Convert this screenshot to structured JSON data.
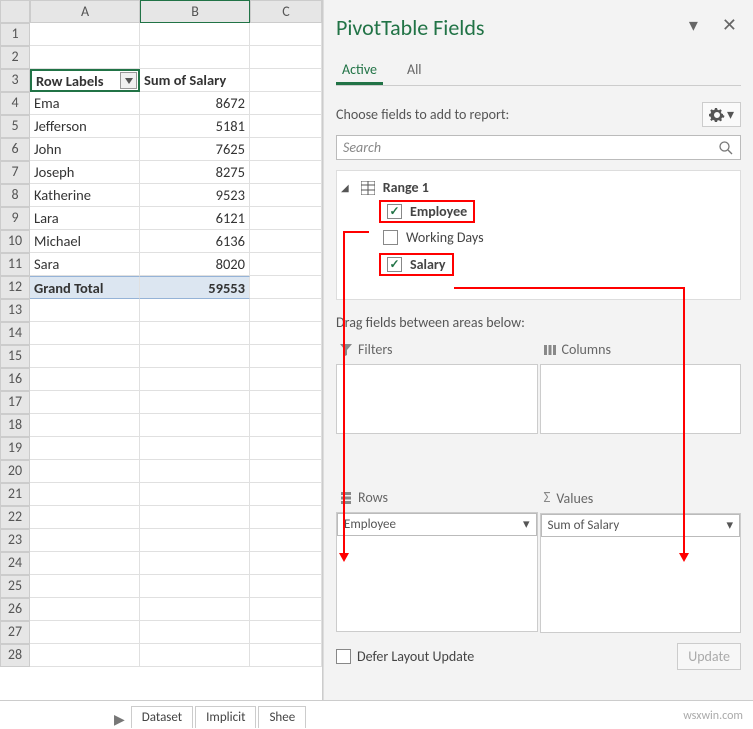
{
  "spreadsheet": {
    "columns": [
      "A",
      "B",
      "C"
    ],
    "header_row": {
      "a": "Row Labels",
      "b": "Sum of Salary"
    },
    "rows": [
      {
        "n": 4,
        "a": "Ema",
        "b": "8672"
      },
      {
        "n": 5,
        "a": "Jefferson",
        "b": "5181"
      },
      {
        "n": 6,
        "a": "John",
        "b": "7625"
      },
      {
        "n": 7,
        "a": "Joseph",
        "b": "8275"
      },
      {
        "n": 8,
        "a": "Katherine",
        "b": "9523"
      },
      {
        "n": 9,
        "a": "Lara",
        "b": "6121"
      },
      {
        "n": 10,
        "a": "Michael",
        "b": "6136"
      },
      {
        "n": 11,
        "a": "Sara",
        "b": "8020"
      }
    ],
    "grand_total": {
      "n": 12,
      "a": "Grand Total",
      "b": "59553"
    },
    "blank_rows": [
      1,
      2,
      13,
      14,
      15,
      16,
      17,
      18,
      19,
      20,
      21,
      22,
      23,
      24,
      25,
      26,
      27,
      28
    ],
    "tabs": [
      "Dataset",
      "Implicit",
      "Shee"
    ]
  },
  "pane": {
    "title": "PivotTable Fields",
    "tabs": {
      "active": "Active",
      "all": "All"
    },
    "choose_text": "Choose fields to add to report:",
    "search_placeholder": "Search",
    "range_name": "Range 1",
    "fields": [
      {
        "name": "Employee",
        "checked": true,
        "highlight": true
      },
      {
        "name": "Working Days",
        "checked": false,
        "highlight": false
      },
      {
        "name": "Salary",
        "checked": true,
        "highlight": true
      }
    ],
    "drag_text": "Drag fields between areas below:",
    "areas": {
      "filters": "Filters",
      "columns": "Columns",
      "rows": "Rows",
      "values": "Values"
    },
    "rows_pill": "Employee",
    "values_pill": "Sum of Salary",
    "defer": "Defer Layout Update",
    "update_btn": "Update"
  },
  "watermark": "wsxwin.com"
}
